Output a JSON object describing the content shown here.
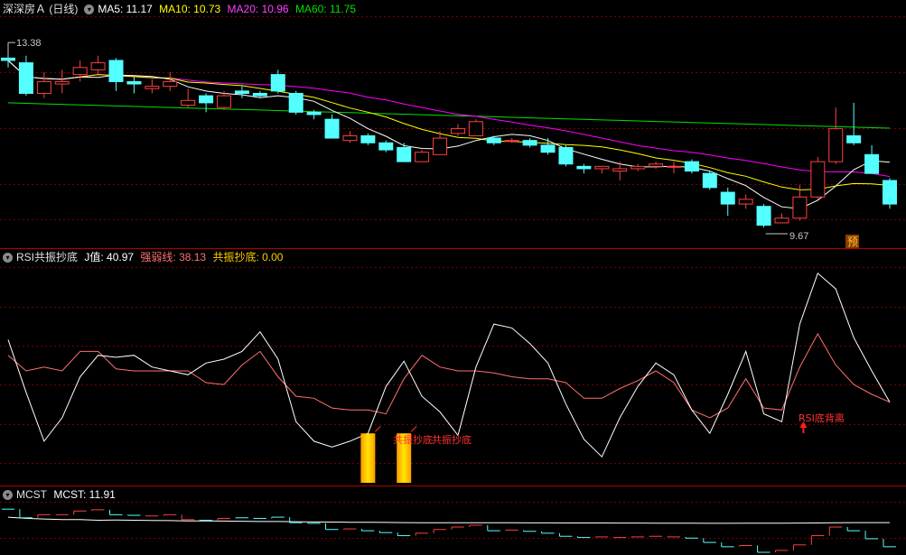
{
  "main_header": {
    "stock_name": "深深房Ａ (日线)",
    "ma5": "MA5: 11.17",
    "ma10": "MA10: 10.73",
    "ma20": "MA20: 10.96",
    "ma60": "MA60: 11.75",
    "high_label": "13.38",
    "low_label": "9.67",
    "forecast_badge": "预"
  },
  "rsi_header": {
    "name": "RSI共振抄底",
    "j": "J值: 40.97",
    "weak": "强弱线: 38.13",
    "bottom": "共振抄底: 0.00",
    "annotation1": "共振抄底",
    "annotation2": "共振抄底",
    "divergence": "RSI底背离"
  },
  "mcst_header": {
    "name": "MCST",
    "value": "MCST: 11.91"
  },
  "colors": {
    "up": "#ff4040",
    "down": "#54ffff",
    "ma5": "#ffffff",
    "ma10": "#ffff00",
    "ma20": "#ff00ff",
    "ma60": "#00e000",
    "weak_line": "#ff7070",
    "j_line": "#ffffff",
    "bottom_signal": "#ffcc00",
    "grid": "#7a0000"
  },
  "chart_data": [
    {
      "type": "candlestick",
      "panel": "price",
      "ylim": [
        9.3,
        13.9
      ],
      "candles": [
        [
          13.05,
          13.0,
          13.38,
          12.85
        ],
        [
          12.95,
          12.3,
          13.1,
          12.25
        ],
        [
          12.3,
          12.55,
          12.75,
          12.2
        ],
        [
          12.5,
          12.55,
          12.8,
          12.3
        ],
        [
          12.7,
          12.85,
          13.0,
          12.55
        ],
        [
          12.8,
          12.95,
          13.1,
          12.7
        ],
        [
          13.0,
          12.55,
          13.05,
          12.35
        ],
        [
          12.55,
          12.5,
          12.65,
          12.3
        ],
        [
          12.4,
          12.45,
          12.6,
          12.3
        ],
        [
          12.45,
          12.55,
          12.75,
          12.35
        ],
        [
          12.05,
          12.15,
          12.4,
          12.0
        ],
        [
          12.25,
          12.1,
          12.3,
          11.9
        ],
        [
          12.0,
          12.25,
          12.35,
          11.95
        ],
        [
          12.35,
          12.3,
          12.45,
          12.2
        ],
        [
          12.3,
          12.25,
          12.35,
          12.2
        ],
        [
          12.7,
          12.35,
          12.8,
          12.3
        ],
        [
          12.3,
          11.9,
          12.35,
          11.85
        ],
        [
          11.9,
          11.85,
          11.95,
          11.75
        ],
        [
          11.75,
          11.35,
          11.85,
          11.35
        ],
        [
          11.3,
          11.4,
          11.5,
          11.25
        ],
        [
          11.4,
          11.25,
          11.45,
          11.2
        ],
        [
          11.25,
          11.1,
          11.3,
          11.05
        ],
        [
          11.15,
          10.85,
          11.25,
          10.85
        ],
        [
          10.85,
          11.05,
          11.1,
          10.85
        ],
        [
          11.0,
          11.35,
          11.5,
          11.0
        ],
        [
          11.45,
          11.55,
          11.65,
          11.4
        ],
        [
          11.4,
          11.7,
          11.75,
          11.4
        ],
        [
          11.35,
          11.25,
          11.4,
          11.2
        ],
        [
          11.3,
          11.3,
          11.35,
          11.25
        ],
        [
          11.3,
          11.2,
          11.35,
          11.15
        ],
        [
          11.2,
          11.05,
          11.35,
          11.0
        ],
        [
          11.15,
          10.8,
          11.2,
          10.75
        ],
        [
          10.75,
          10.7,
          10.8,
          10.6
        ],
        [
          10.7,
          10.75,
          10.75,
          10.6
        ],
        [
          10.65,
          10.7,
          10.85,
          10.45
        ],
        [
          10.7,
          10.75,
          10.8,
          10.65
        ],
        [
          10.75,
          10.8,
          10.85,
          10.7
        ],
        [
          10.75,
          10.75,
          10.85,
          10.6
        ],
        [
          10.85,
          10.65,
          10.9,
          10.6
        ],
        [
          10.6,
          10.3,
          10.65,
          10.25
        ],
        [
          10.2,
          9.95,
          10.3,
          9.7
        ],
        [
          9.95,
          10.05,
          10.15,
          9.85
        ],
        [
          9.9,
          9.5,
          9.95,
          9.45
        ],
        [
          9.55,
          9.65,
          9.75,
          9.55
        ],
        [
          9.65,
          10.1,
          10.35,
          9.6
        ],
        [
          10.1,
          10.85,
          10.95,
          10.05
        ],
        [
          10.85,
          11.55,
          12.0,
          10.8
        ],
        [
          11.4,
          11.25,
          12.1,
          11.2
        ],
        [
          11.0,
          10.6,
          11.2,
          10.6
        ],
        [
          10.45,
          9.95,
          10.5,
          9.85
        ]
      ]
    },
    {
      "type": "line",
      "panel": "rsi",
      "ylim": [
        -5,
        105
      ],
      "series": [
        {
          "name": "J值",
          "values": [
            66,
            39,
            14,
            26,
            47,
            58,
            57,
            58,
            52,
            50,
            48,
            54,
            56,
            60,
            70,
            56,
            24,
            14,
            11,
            14,
            18,
            42,
            55,
            37,
            29,
            17,
            52,
            74,
            72,
            64,
            54,
            33,
            15,
            6,
            26,
            42,
            54,
            48,
            30,
            18,
            38,
            60,
            28,
            24,
            74,
            100,
            92,
            67,
            50,
            34
          ]
        },
        {
          "name": "强弱线",
          "values": [
            58,
            50,
            52,
            50,
            60,
            60,
            51,
            50,
            50,
            50,
            50,
            44,
            43,
            53,
            60,
            47,
            37,
            36,
            31,
            30,
            30,
            28,
            46,
            58,
            52,
            50,
            50,
            49,
            47,
            46,
            46,
            44,
            36,
            36,
            41,
            45,
            50,
            44,
            30,
            26,
            31,
            46,
            31,
            30,
            52,
            69,
            53,
            43,
            38,
            34
          ]
        }
      ],
      "signals": [
        20,
        22
      ],
      "signal_value": 18,
      "divergence_index": 44
    },
    {
      "type": "line",
      "panel": "mcst",
      "ylim": [
        9.5,
        13.6
      ],
      "series": [
        {
          "name": "MCST",
          "values": [
            12.35,
            12.25,
            12.2,
            12.15,
            12.15,
            12.1,
            12.12,
            12.1,
            12.08,
            12.07,
            12.05,
            12.04,
            12.03,
            12.02,
            12.0,
            12.0,
            11.98,
            11.96,
            11.95,
            11.94,
            11.93,
            11.92,
            11.91,
            11.9,
            11.9,
            11.9,
            11.9,
            11.9,
            11.9,
            11.89,
            11.89,
            11.88,
            11.88,
            11.88,
            11.87,
            11.87,
            11.86,
            11.86,
            11.86,
            11.85,
            11.85,
            11.86,
            11.86,
            11.86,
            11.87,
            11.88,
            11.9,
            11.91,
            11.91,
            11.91
          ]
        }
      ]
    }
  ]
}
